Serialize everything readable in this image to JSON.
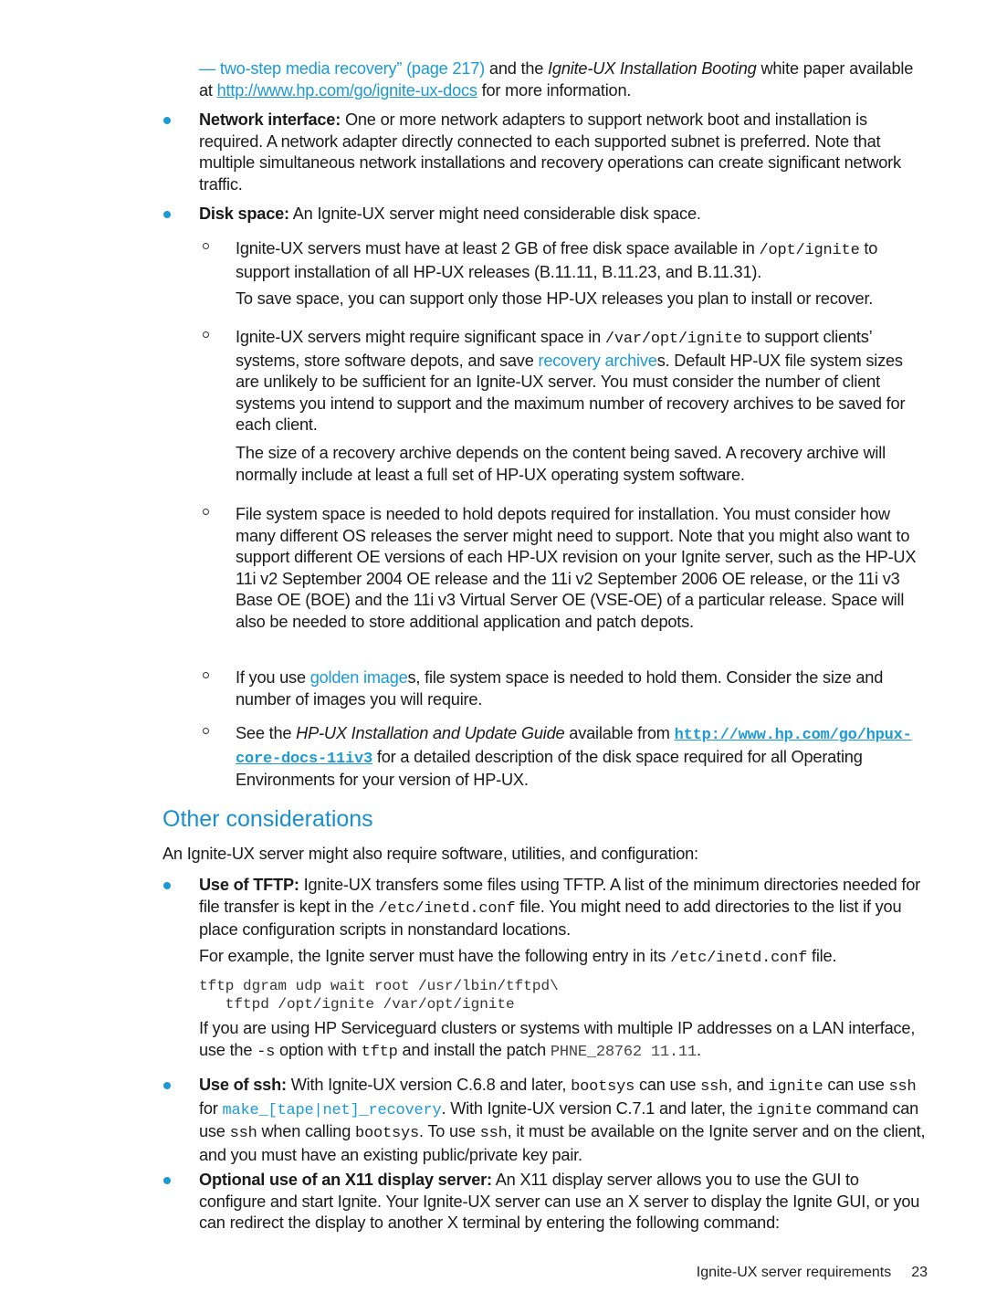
{
  "page": {
    "continuation": {
      "link_text": "— two-step media recovery” (page 217)",
      "text_1": " and the ",
      "doc_title": "Ignite-UX Installation Booting",
      "text_2": " white paper available at ",
      "url": "http://www.hp.com/go/ignite-ux-docs",
      "text_3": " for more information."
    },
    "bullets": {
      "network": {
        "label": "Network interface:",
        "text": " One or more network adapters to support network boot and installation is required. A network adapter directly connected to each supported subnet is preferred. Note that multiple simultaneous network installations and recovery operations can create significant network traffic."
      },
      "disk": {
        "label": "Disk space:",
        "text": " An Ignite-UX server might need considerable disk space.",
        "sub": {
          "opt": {
            "text_1": "Ignite-UX servers must have at least 2 GB of free disk space available in ",
            "code": "/opt/ignite",
            "text_2": " to support installation of all HP-UX releases (B.11.11, B.11.23, and B.11.31).",
            "note": "To save space, you can support only those HP-UX releases you plan to install or recover."
          },
          "var": {
            "text_1": "Ignite-UX servers might require significant space in ",
            "code": "/var/opt/ignite",
            "text_2": " to support clients’ systems, store software depots, and save ",
            "link": "recovery archive",
            "text_3": "s. Default HP-UX file system sizes are unlikely to be sufficient for an Ignite-UX server. You must consider the number of client systems you intend to support and the maximum number of recovery archives to be saved for each client.",
            "note": "The size of a recovery archive depends on the content being saved. A recovery archive will normally include at least a full set of HP-UX operating system software."
          },
          "fs": {
            "text": "File system space is needed to hold depots required for installation. You must consider how many different OS releases the server might need to support. Note that you might also want to support different OE versions of each HP-UX revision on your Ignite server, such as the HP-UX 11i v2 September 2004 OE release and the 11i v2 September 2006 OE release, or the 11i v3 Base OE (BOE) and the 11i v3 Virtual Server OE (VSE-OE) of a particular release. Space will also be needed to store additional application and patch depots."
          },
          "golden": {
            "text_1": "If you use ",
            "link": "golden image",
            "text_2": "s, file system space is needed to hold them. Consider the size and number of images you will require."
          },
          "guide": {
            "text_1": "See the ",
            "doc_title": "HP-UX Installation and Update Guide",
            "text_2": " available from ",
            "url": "http://www.hp.com/go/hpux-core-docs-11iv3",
            "text_3": " for a detailed description of the disk space required for all Operating Environments for your version of HP-UX."
          }
        }
      }
    },
    "section": {
      "heading": "Other considerations",
      "intro": "An Ignite-UX server might also require software, utilities, and configuration:",
      "tftp": {
        "label": "Use of TFTP:",
        "text_1": " Ignite-UX transfers some files using TFTP. A list of the minimum directories needed for file transfer is kept in the ",
        "code": "/etc/inetd.conf",
        "text_2": " file. You might need to add directories to the list if you place configuration scripts in nonstandard locations.",
        "example_1": "For example, the Ignite server must have the following entry in its ",
        "example_code": "/etc/inetd.conf",
        "example_2": " file.",
        "code_line_1": "tftp dgram udp wait root /usr/lbin/tftpd\\",
        "code_line_2": "   tftpd /opt/ignite /var/opt/ignite",
        "sg_1": "If you are using HP Serviceguard clusters or systems with multiple IP addresses on a LAN interface, use the ",
        "sg_opt": "-s",
        "sg_2": " option with ",
        "sg_cmd": "tftp",
        "sg_3": " and install the patch ",
        "sg_patch": "PHNE_28762 11.11",
        "sg_4": "."
      },
      "ssh": {
        "label": "Use of ssh:",
        "t1": " With Ignite-UX version C.6.8 and later, ",
        "c1": "bootsys",
        "t2": " can use ",
        "c2": "ssh",
        "t3": ", and ",
        "c3": "ignite",
        "t4": " can use ",
        "c4": "ssh",
        "t5": " for ",
        "link": "make_[tape|net]_recovery",
        "t6": ". With Ignite-UX version C.7.1 and later, the ",
        "c5": "ignite",
        "t7": " command can use ",
        "c6": "ssh",
        "t8": " when calling ",
        "c7": "bootsys",
        "t9": ". To use ",
        "c8": "ssh",
        "t10": ", it must be available on the Ignite server and on the client, and you must have an existing public/private key pair."
      },
      "x11": {
        "label": "Optional use of an X11 display server:",
        "text": " An X11 display server allows you to use the GUI to configure and start Ignite. Your Ignite-UX server can use an X server to display the Ignite GUI, or you can redirect the display to another X terminal by entering the following command:"
      }
    },
    "footer": {
      "section_title": "Ignite-UX server requirements",
      "page_number": "23"
    }
  }
}
